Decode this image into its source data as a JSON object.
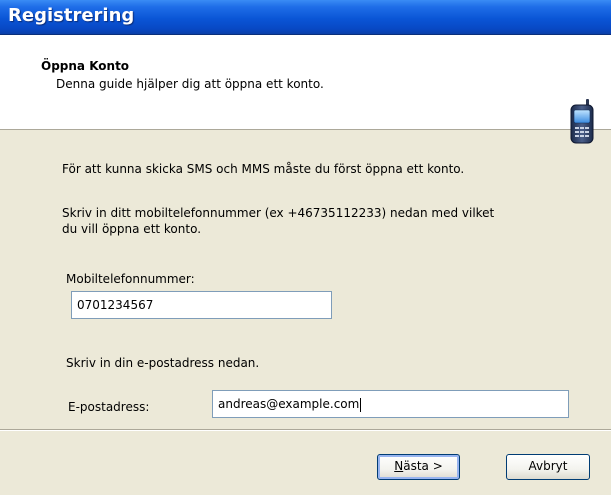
{
  "window": {
    "title": "Registrering"
  },
  "header": {
    "title": "Öppna Konto",
    "description": "Denna guide hjälper dig att öppna ett konto.",
    "icon": "mobile-phone-icon"
  },
  "content": {
    "intro": "För att kunna skicka SMS och MMS måste du först öppna ett konto.",
    "instructions_line1": "Skriv in ditt mobiltelefonnummer (ex +46735112233) nedan med vilket",
    "instructions_line2": "du vill öppna ett konto.",
    "phone_label": "Mobiltelefonnummer:",
    "phone_value": "0701234567",
    "email_instructions": "Skriv in din e-postadress nedan.",
    "email_label": "E-postadress:",
    "email_value": "andreas@example.com"
  },
  "buttons": {
    "next_accel": "N",
    "next_rest": "ästa >",
    "cancel": "Avbryt"
  },
  "colors": {
    "titlebar": "#0a55d6",
    "dialog_bg": "#ece9d8"
  }
}
